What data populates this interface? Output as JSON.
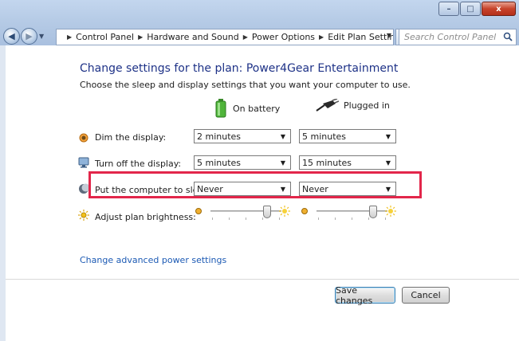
{
  "window": {
    "controls": {
      "minimize": "–",
      "maximize": "□",
      "close": "x"
    }
  },
  "nav": {
    "back": "◀",
    "forward": "▶",
    "breadcrumbs": [
      "Control Panel",
      "Hardware and Sound",
      "Power Options",
      "Edit Plan Settings"
    ],
    "refresh": "↻",
    "search_placeholder": "Search Control Panel"
  },
  "page": {
    "title": "Change settings for the plan: Power4Gear Entertainment",
    "subtitle": "Choose the sleep and display settings that you want your computer to use."
  },
  "columns": {
    "battery": "On battery",
    "plugged": "Plugged in"
  },
  "settings": [
    {
      "label": "Dim the display:",
      "battery": "2 minutes",
      "plugged": "5 minutes",
      "icon": "dim-display-icon"
    },
    {
      "label": "Turn off the display:",
      "battery": "5 minutes",
      "plugged": "15 minutes",
      "icon": "monitor-icon"
    },
    {
      "label": "Put the computer to sleep:",
      "battery": "Never",
      "plugged": "Never",
      "icon": "sleep-moon-icon"
    }
  ],
  "brightness": {
    "label": "Adjust plan brightness:",
    "battery_level": 0.8,
    "plugged_level": 0.8
  },
  "advanced_link": "Change advanced power settings",
  "buttons": {
    "save": "Save changes",
    "cancel": "Cancel"
  },
  "colors": {
    "title": "#1e3287",
    "link": "#1c5ab4",
    "highlight": "#e2264a"
  }
}
